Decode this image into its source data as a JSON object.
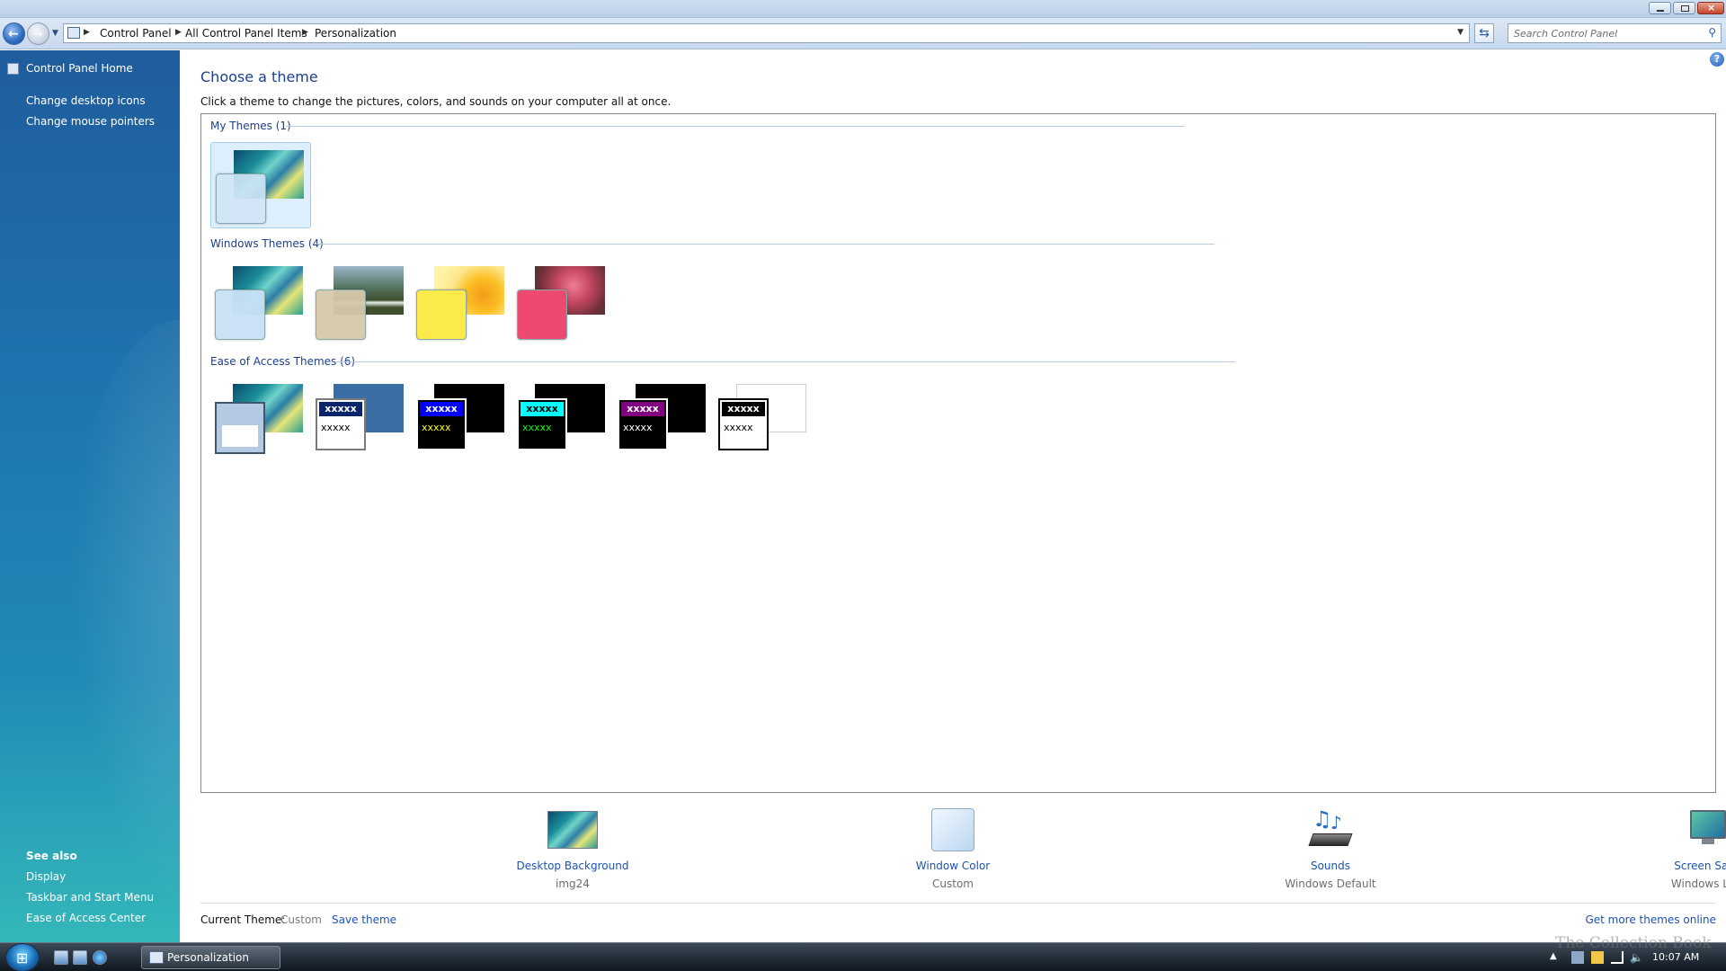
{
  "window": {
    "buttons": {
      "minimize": "minimize",
      "maximize": "restore",
      "close": "close"
    }
  },
  "address": {
    "crumbs": [
      "Control Panel",
      "All Control Panel Items",
      "Personalization"
    ],
    "search_placeholder": "Search Control Panel"
  },
  "sidebar": {
    "home": "Control Panel Home",
    "links": [
      "Change desktop icons",
      "Change mouse pointers"
    ],
    "see_also_title": "See also",
    "see_also": [
      "Display",
      "Taskbar and Start Menu",
      "Ease of Access Center"
    ]
  },
  "main": {
    "title": "Choose a theme",
    "description": "Click a theme to change the pictures, colors, and sounds on your computer all at once.",
    "groups": {
      "my_themes": "My Themes (1)",
      "windows_themes": "Windows Themes (4)",
      "ease_themes": "Ease of Access Themes (6)"
    },
    "hc_sample": "xxxxx",
    "tiles": [
      {
        "label": "Desktop Background",
        "value": "img24"
      },
      {
        "label": "Window Color",
        "value": "Custom"
      },
      {
        "label": "Sounds",
        "value": "Windows Default"
      },
      {
        "label": "Screen Saver",
        "value": "Windows Logo"
      }
    ],
    "current_theme_label": "Current Theme:",
    "current_theme_value": "Custom",
    "save_theme": "Save theme",
    "get_more": "Get more themes online"
  },
  "taskbar": {
    "active_window": "Personalization",
    "clock": "10:07 AM"
  },
  "watermark": "The Collection Book",
  "colors": {
    "link": "#1e52b2",
    "heading": "#1e3f8a",
    "hc1_title_bg": "#ffffff",
    "hc1_title_fg": "#1e3f8a",
    "hc2_title_bg": "#0000ff",
    "hc2_text": "#ffff00",
    "hc3_title_bg": "#00ffff",
    "hc3_text": "#00ff00",
    "hc4_title_bg": "#800080",
    "hc4_text": "#ffffff",
    "hcwhite_title_bg": "#000000"
  }
}
